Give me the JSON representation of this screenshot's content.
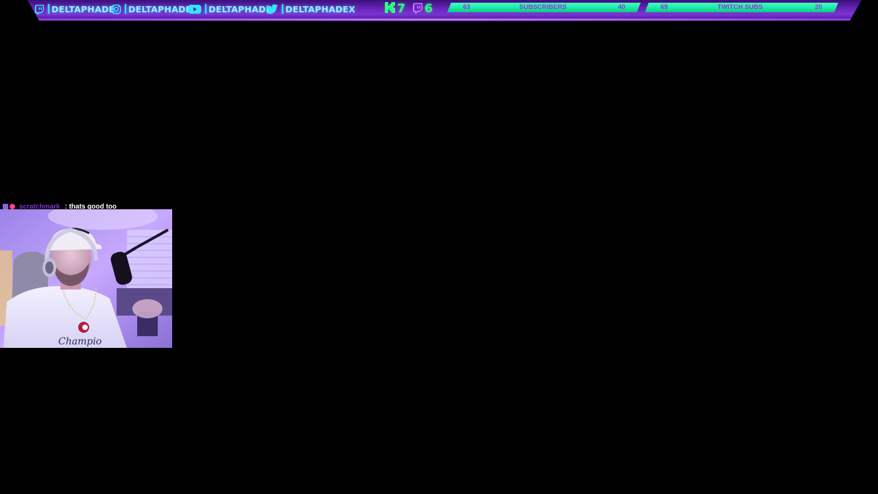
{
  "socials": [
    {
      "icon": "twitch-icon",
      "handle": "DELTAPHADE"
    },
    {
      "icon": "instagram-icon",
      "handle": "DELTAPHADE"
    },
    {
      "icon": "youtube-icon",
      "handle": "DELTAPHADE"
    },
    {
      "icon": "twitter-icon",
      "handle": "DELTAPHADEX"
    }
  ],
  "stats": [
    {
      "icon": "kick-icon",
      "value": "7"
    },
    {
      "icon": "twitch-icon",
      "value": "6"
    }
  ],
  "goals": [
    {
      "left_number": "63",
      "label": "SUBSCRIBERS",
      "right_number": "40"
    },
    {
      "left_number": "69",
      "label": "TWITCH SUBS",
      "right_number": "20"
    }
  ],
  "chat": {
    "username": "scratchmark",
    "message": ": thats good too"
  },
  "colors": {
    "bar_purple": "#6b25bf",
    "handle_cyan": "#8ff3ff",
    "goal_green": "#18e6a0",
    "goal_text_purple": "#9b2fd6",
    "stat_green": "#2cff7e",
    "chat_username_purple": "#7b35c9",
    "background": "#000000"
  }
}
